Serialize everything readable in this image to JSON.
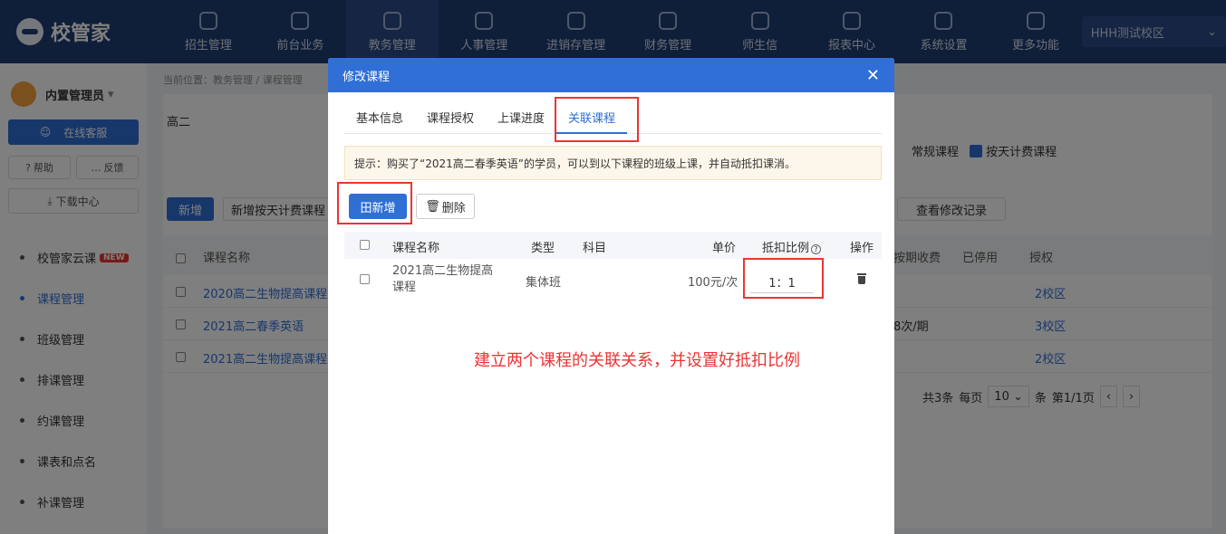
{
  "app": {
    "logo_text": "校管家",
    "campus": "HHH测试校区"
  },
  "nav": [
    {
      "label": "招生管理",
      "icon": "user-plus-icon"
    },
    {
      "label": "前台业务",
      "icon": "monitor-icon"
    },
    {
      "label": "教务管理",
      "icon": "book-icon"
    },
    {
      "label": "人事管理",
      "icon": "person-icon"
    },
    {
      "label": "进销存管理",
      "icon": "inventory-icon"
    },
    {
      "label": "财务管理",
      "icon": "finance-icon"
    },
    {
      "label": "师生信",
      "icon": "chat-icon"
    },
    {
      "label": "报表中心",
      "icon": "report-icon"
    },
    {
      "label": "系统设置",
      "icon": "settings-icon"
    },
    {
      "label": "更多功能",
      "icon": "more-icon"
    }
  ],
  "sidebar": {
    "user": "内置管理员",
    "service": "在线客服",
    "help": "帮助",
    "feedback": "反馈",
    "download": "下载中心",
    "menu": [
      {
        "label": "校管家云课",
        "badge": "NEW"
      },
      {
        "label": "课程管理"
      },
      {
        "label": "班级管理"
      },
      {
        "label": "排课管理"
      },
      {
        "label": "约课管理"
      },
      {
        "label": "课表和点名"
      },
      {
        "label": "补课管理"
      }
    ]
  },
  "bg": {
    "crumb": "当前位置：教务管理 / 课程管理",
    "filter": "高二",
    "check_regular": "常规课程",
    "check_daily": "按天计费课程",
    "btn_new": "新增",
    "btn_new_daily": "新增按天计费课程",
    "btn_log": "查看修改记录",
    "headers": {
      "name": "课程名称",
      "period": "按期收费",
      "stopped": "已停用",
      "auth": "授权"
    },
    "rows": [
      {
        "name": "2020高二生物提高课程",
        "period": "",
        "auth": "2校区"
      },
      {
        "name": "2021高二春季英语",
        "period": "8次/期",
        "auth": "3校区"
      },
      {
        "name": "2021高二生物提高课程",
        "period": "",
        "auth": "2校区"
      }
    ],
    "pager": {
      "total": "共3条",
      "per": "每页",
      "size": "10",
      "unit": "条",
      "page": "第1/1页"
    }
  },
  "modal": {
    "title": "修改课程",
    "tabs": [
      "基本信息",
      "课程授权",
      "上课进度",
      "关联课程"
    ],
    "tip": "提示：购买了“2021高二春季英语”的学员，可以到以下课程的班级上课，并自动抵扣课消。",
    "btn_add": "田新增",
    "btn_delete": "删除",
    "headers": {
      "name": "课程名称",
      "type": "类型",
      "subject": "科目",
      "price": "单价",
      "ratio": "抵扣比例",
      "action": "操作"
    },
    "row": {
      "name": "2021高二生物提高课程",
      "type": "集体班",
      "subject": "",
      "price": "100元/次",
      "ratio": "1：1"
    },
    "annotation": "建立两个课程的关联关系，并设置好抵扣比例"
  }
}
